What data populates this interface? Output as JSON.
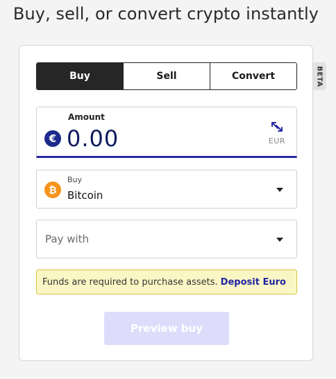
{
  "headline": "Buy, sell, or convert crypto instantly",
  "beta_label": "BETA",
  "tabs": [
    {
      "label": "Buy",
      "active": true
    },
    {
      "label": "Sell",
      "active": false
    },
    {
      "label": "Convert",
      "active": false
    }
  ],
  "amount": {
    "label": "Amount",
    "value": "0.00",
    "currency_symbol": "€",
    "currency_code": "EUR",
    "swap_icon": "swap-arrows-icon"
  },
  "asset_select": {
    "caption": "Buy",
    "value": "Bitcoin",
    "coin_symbol": "₿"
  },
  "pay_select": {
    "placeholder": "Pay with"
  },
  "notice": {
    "text": "Funds are required to purchase assets.",
    "link": "Deposit Euro"
  },
  "preview_button": {
    "label": "Preview buy",
    "disabled": true
  },
  "colors": {
    "accent": "#2b2aa4",
    "euro_badge": "#1b2a8c",
    "bitcoin": "#f7931a",
    "notice_bg": "#fbf7c5",
    "button_disabled": "#dedcfb"
  }
}
